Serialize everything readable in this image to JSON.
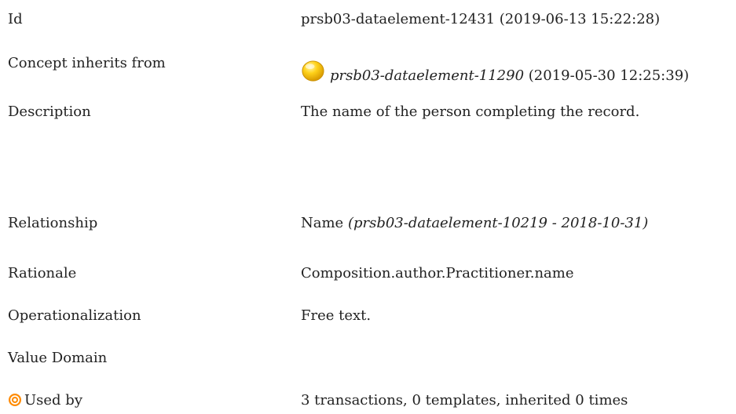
{
  "rows": {
    "id": {
      "label": "Id",
      "value": "prsb03-dataelement-12431 (2019-06-13 15:22:28)"
    },
    "inherits": {
      "label": "Concept inherits from",
      "link": "prsb03-dataelement-11290",
      "date": "(2019-05-30 12:25:39)",
      "icon": "yellow-orb-icon"
    },
    "description": {
      "label": "Description",
      "value": "The name of the person completing the record."
    },
    "relationship": {
      "label": "Relationship",
      "name": "Name",
      "ref": "(prsb03-dataelement-10219 - 2018-10-31)"
    },
    "rationale": {
      "label": "Rationale",
      "value": "Composition.author.Practitioner.name"
    },
    "operationalization": {
      "label": "Operationalization",
      "value": "Free text."
    },
    "value_domain": {
      "label": "Value Domain",
      "value": ""
    },
    "used_by": {
      "label": "Used by",
      "value": "3 transactions, 0 templates, inherited 0 times",
      "icon": "target-icon"
    }
  },
  "colors": {
    "text": "#222222",
    "orb": "#f5c400",
    "target": "#ff8a00"
  }
}
